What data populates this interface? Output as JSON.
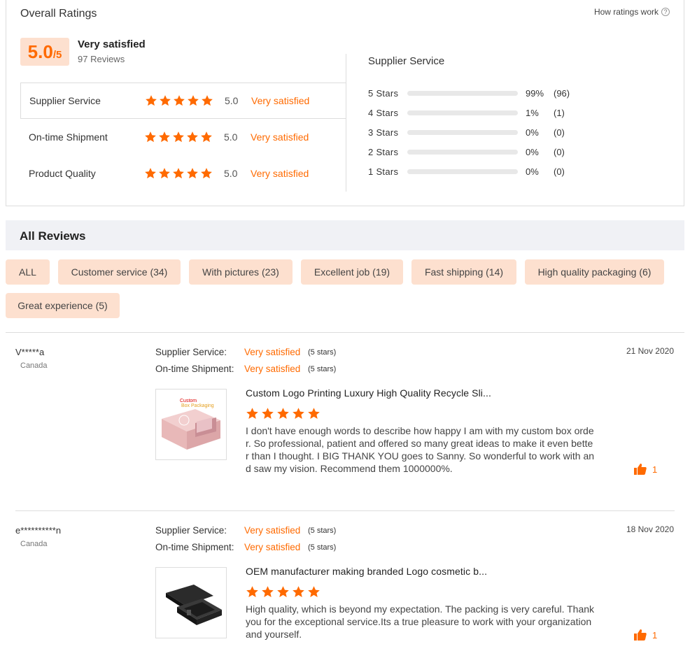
{
  "overall": {
    "title": "Overall Ratings",
    "how_link": "How ratings work",
    "help_glyph": "?",
    "score": "5.0",
    "score_of": "/5",
    "label": "Very satisfied",
    "reviews": "97 Reviews",
    "categories": [
      {
        "name": "Supplier Service",
        "score": "5.0",
        "text": "Very satisfied",
        "stars": 5
      },
      {
        "name": "On-time Shipment",
        "score": "5.0",
        "text": "Very satisfied",
        "stars": 5
      },
      {
        "name": "Product Quality",
        "score": "5.0",
        "text": "Very satisfied",
        "stars": 5
      }
    ]
  },
  "distribution": {
    "title": "Supplier Service",
    "rows": [
      {
        "label": "5 Stars",
        "pct": "99%",
        "count": "(96)",
        "fraction": 0.99
      },
      {
        "label": "4 Stars",
        "pct": "1%",
        "count": "(1)",
        "fraction": 0.01
      },
      {
        "label": "3 Stars",
        "pct": "0%",
        "count": "(0)",
        "fraction": 0
      },
      {
        "label": "2 Stars",
        "pct": "0%",
        "count": "(0)",
        "fraction": 0
      },
      {
        "label": "1 Stars",
        "pct": "0%",
        "count": "(0)",
        "fraction": 0
      }
    ]
  },
  "all_reviews": {
    "title": "All Reviews",
    "filters": [
      "ALL",
      "Customer service (34)",
      "With pictures (23)",
      "Excellent job (19)",
      "Fast shipping (14)",
      "High quality packaging (6)",
      "Great experience (5)"
    ]
  },
  "reviews": [
    {
      "user": "V*****a",
      "country": "Canada",
      "date": "21 Nov 2020",
      "service_label": "Supplier Service:",
      "service_value": "Very satisfied",
      "service_stars": "(5 stars)",
      "shipment_label": "On-time Shipment:",
      "shipment_value": "Very satisfied",
      "shipment_stars": "(5 stars)",
      "product": "Custom Logo Printing Luxury High Quality Recycle Sli...",
      "text": "I don't have enough words to describe how happy I am with my custom box order. So professional, patient and offered so many great ideas to make it even better than I thought.  I BIG THANK YOU goes to Sanny.   So wonderful to work with and saw my vision.  Recommend them 1000000%.",
      "likes": "1",
      "thumb_caption_1": "Custom",
      "thumb_caption_2": "Box Packaging",
      "rating": 5
    },
    {
      "user": "e**********n",
      "country": "Canada",
      "date": "18 Nov 2020",
      "service_label": "Supplier Service:",
      "service_value": "Very satisfied",
      "service_stars": "(5 stars)",
      "shipment_label": "On-time Shipment:",
      "shipment_value": "Very satisfied",
      "shipment_stars": "(5 stars)",
      "product": "OEM manufacturer making branded Logo cosmetic b...",
      "text": "High quality, which is beyond my expectation. The packing is very careful. Thank you for the exceptional service.Its a true pleasure to work with your organization and yourself.",
      "likes": "1",
      "rating": 5
    }
  ],
  "colors": {
    "accent": "#ff6a00",
    "chip_bg": "#fde0cf",
    "header_bg": "#f0f1f5"
  }
}
